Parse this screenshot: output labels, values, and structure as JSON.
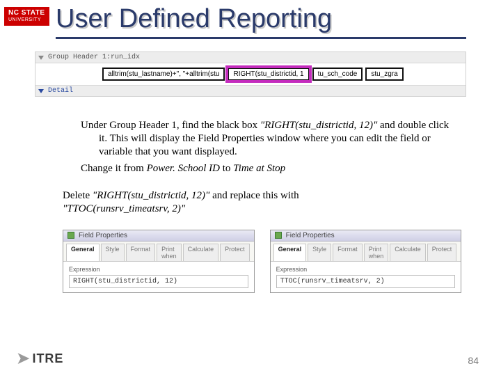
{
  "brand": {
    "top": "NC STATE",
    "sub": "UNIVERSITY"
  },
  "title": {
    "main": "User Defined Reporting",
    "shadow": "User Defined Reporting"
  },
  "shot1": {
    "header": "Group Header 1:run_idx",
    "boxes": [
      "alltrim(stu_lastname)+\", \"+alltrim(stu",
      "RIGHT(stu_districtid, 1",
      "tu_sch_code",
      "stu_zgra"
    ],
    "detail": "Detail"
  },
  "body": {
    "p1a": "Under Group Header 1, find the black box ",
    "p1b": "\"RIGHT(stu_districtid, 12)\"",
    "p1c": " and double click it. This will display the Field Properties window where you can edit the field or variable that you want displayed.",
    "p2a": "Change it from ",
    "p2b": "Power. School ID",
    "p2c": " to ",
    "p2d": "Time at Stop",
    "p3a": "Delete ",
    "p3b": "\"RIGHT(stu_districtid, 12)\" ",
    "p3c": "and replace this with ",
    "p3d": "\"TTOC(runsrv_timeatsrv, 2)\""
  },
  "panels": {
    "title": "Field Properties",
    "tabs": [
      "General",
      "Style",
      "Format",
      "Print when",
      "Calculate",
      "Protect"
    ],
    "exprLabel": "Expression",
    "leftExpr": "RIGHT(stu_districtid, 12)",
    "rightExpr": "TTOC(runsrv_timeatsrv, 2)"
  },
  "footer": {
    "logo": "ITRE",
    "page": "84"
  }
}
